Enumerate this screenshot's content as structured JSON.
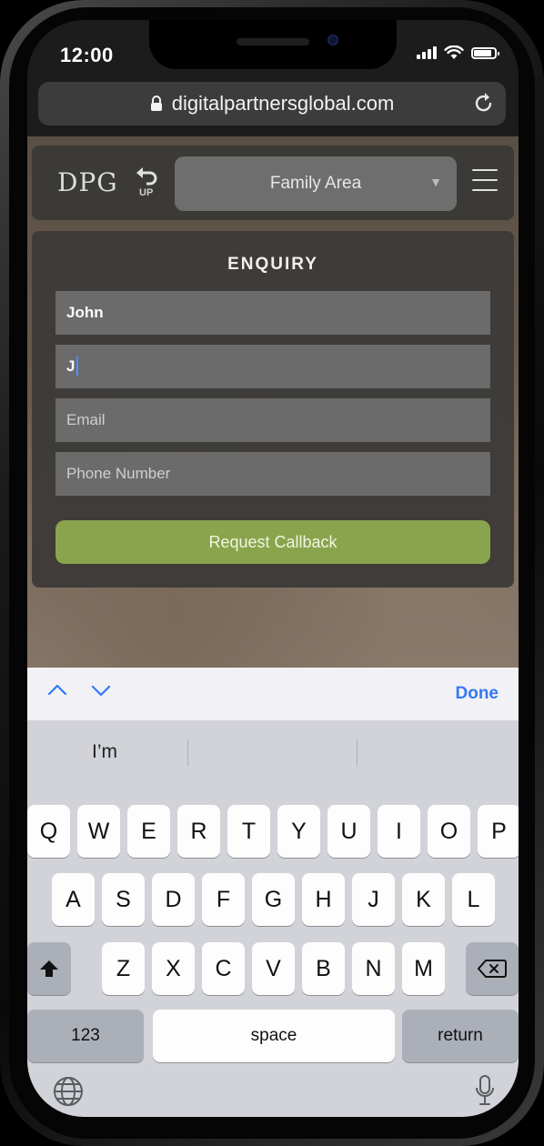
{
  "status_bar": {
    "time": "12:00",
    "battery_level": 0.85
  },
  "browser": {
    "url": "digitalpartnersglobal.com"
  },
  "site_nav": {
    "logo": "DPG",
    "up_label": "UP",
    "page_select_value": "Family Area"
  },
  "enquiry": {
    "title": "ENQUIRY",
    "first_name_value": "John",
    "last_name_value": "J",
    "email_placeholder": "Email",
    "phone_placeholder": "Phone Number",
    "submit_label": "Request Callback"
  },
  "keyboard_toolbar": {
    "done_label": "Done"
  },
  "keyboard": {
    "suggestions": [
      "I’m",
      "",
      ""
    ],
    "row1": [
      "Q",
      "W",
      "E",
      "R",
      "T",
      "Y",
      "U",
      "I",
      "O",
      "P"
    ],
    "row2": [
      "A",
      "S",
      "D",
      "F",
      "G",
      "H",
      "J",
      "K",
      "L"
    ],
    "row3": [
      "Z",
      "X",
      "C",
      "V",
      "B",
      "N",
      "M"
    ],
    "numbers_label": "123",
    "space_label": "space",
    "return_label": "return"
  },
  "colors": {
    "accent_green": "#8aa44e",
    "ios_blue": "#3478f6",
    "field_gray": "#6b6b6b"
  }
}
